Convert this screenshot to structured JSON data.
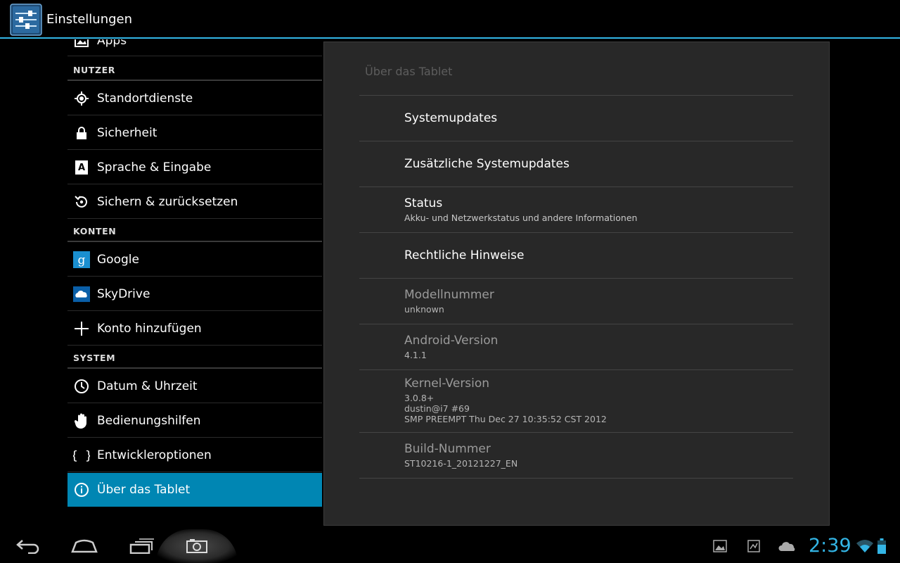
{
  "app": {
    "title": "Einstellungen",
    "icon": "settings-sliders-icon"
  },
  "sidebar": {
    "partial_item": {
      "label": "Apps",
      "icon": "apps-icon"
    },
    "sections": [
      {
        "header": "NUTZER",
        "items": [
          {
            "label": "Standortdienste",
            "icon": "location-icon"
          },
          {
            "label": "Sicherheit",
            "icon": "lock-icon"
          },
          {
            "label": "Sprache & Eingabe",
            "icon": "language-icon"
          },
          {
            "label": "Sichern & zurücksetzen",
            "icon": "backup-restore-icon"
          }
        ]
      },
      {
        "header": "KONTEN",
        "items": [
          {
            "label": "Google",
            "icon": "google-icon"
          },
          {
            "label": "SkyDrive",
            "icon": "skydrive-icon"
          },
          {
            "label": "Konto hinzufügen",
            "icon": "plus-icon"
          }
        ]
      },
      {
        "header": "SYSTEM",
        "items": [
          {
            "label": "Datum & Uhrzeit",
            "icon": "clock-icon"
          },
          {
            "label": "Bedienungshilfen",
            "icon": "hand-icon"
          },
          {
            "label": "Entwickleroptionen",
            "icon": "braces-icon"
          },
          {
            "label": "Über das Tablet",
            "icon": "info-icon",
            "selected": true
          }
        ]
      }
    ]
  },
  "detail": {
    "breadcrumb": "Über das Tablet",
    "items": [
      {
        "title": "Systemupdates"
      },
      {
        "title": "Zusätzliche Systemupdates"
      },
      {
        "title": "Status",
        "summary": "Akku- und Netzwerkstatus und andere Informationen"
      },
      {
        "title": "Rechtliche Hinweise"
      },
      {
        "title": "Modellnummer",
        "summary": "unknown"
      },
      {
        "title": "Android-Version",
        "summary": "4.1.1"
      },
      {
        "title": "Kernel-Version",
        "summary_lines": [
          "3.0.8+",
          "dustin@i7 #69",
          "SMP PREEMPT Thu Dec 27 10:35:52 CST 2012"
        ]
      },
      {
        "title": "Build-Nummer",
        "summary": "ST10216-1_20121227_EN"
      }
    ]
  },
  "navbar": {
    "back_icon": "back-icon",
    "home_icon": "home-icon",
    "recents_icon": "recent-apps-icon",
    "screenshot_icon": "camera-icon",
    "notification_icons": [
      "gallery-notification-icon",
      "image-notification-icon",
      "cloud-notification-icon"
    ],
    "clock": "2:39",
    "wifi_icon": "wifi-icon",
    "battery_icon": "battery-icon"
  },
  "colors": {
    "accent": "#33b5e5",
    "selected_row": "#0086b3",
    "panel_bg": "#282828"
  }
}
